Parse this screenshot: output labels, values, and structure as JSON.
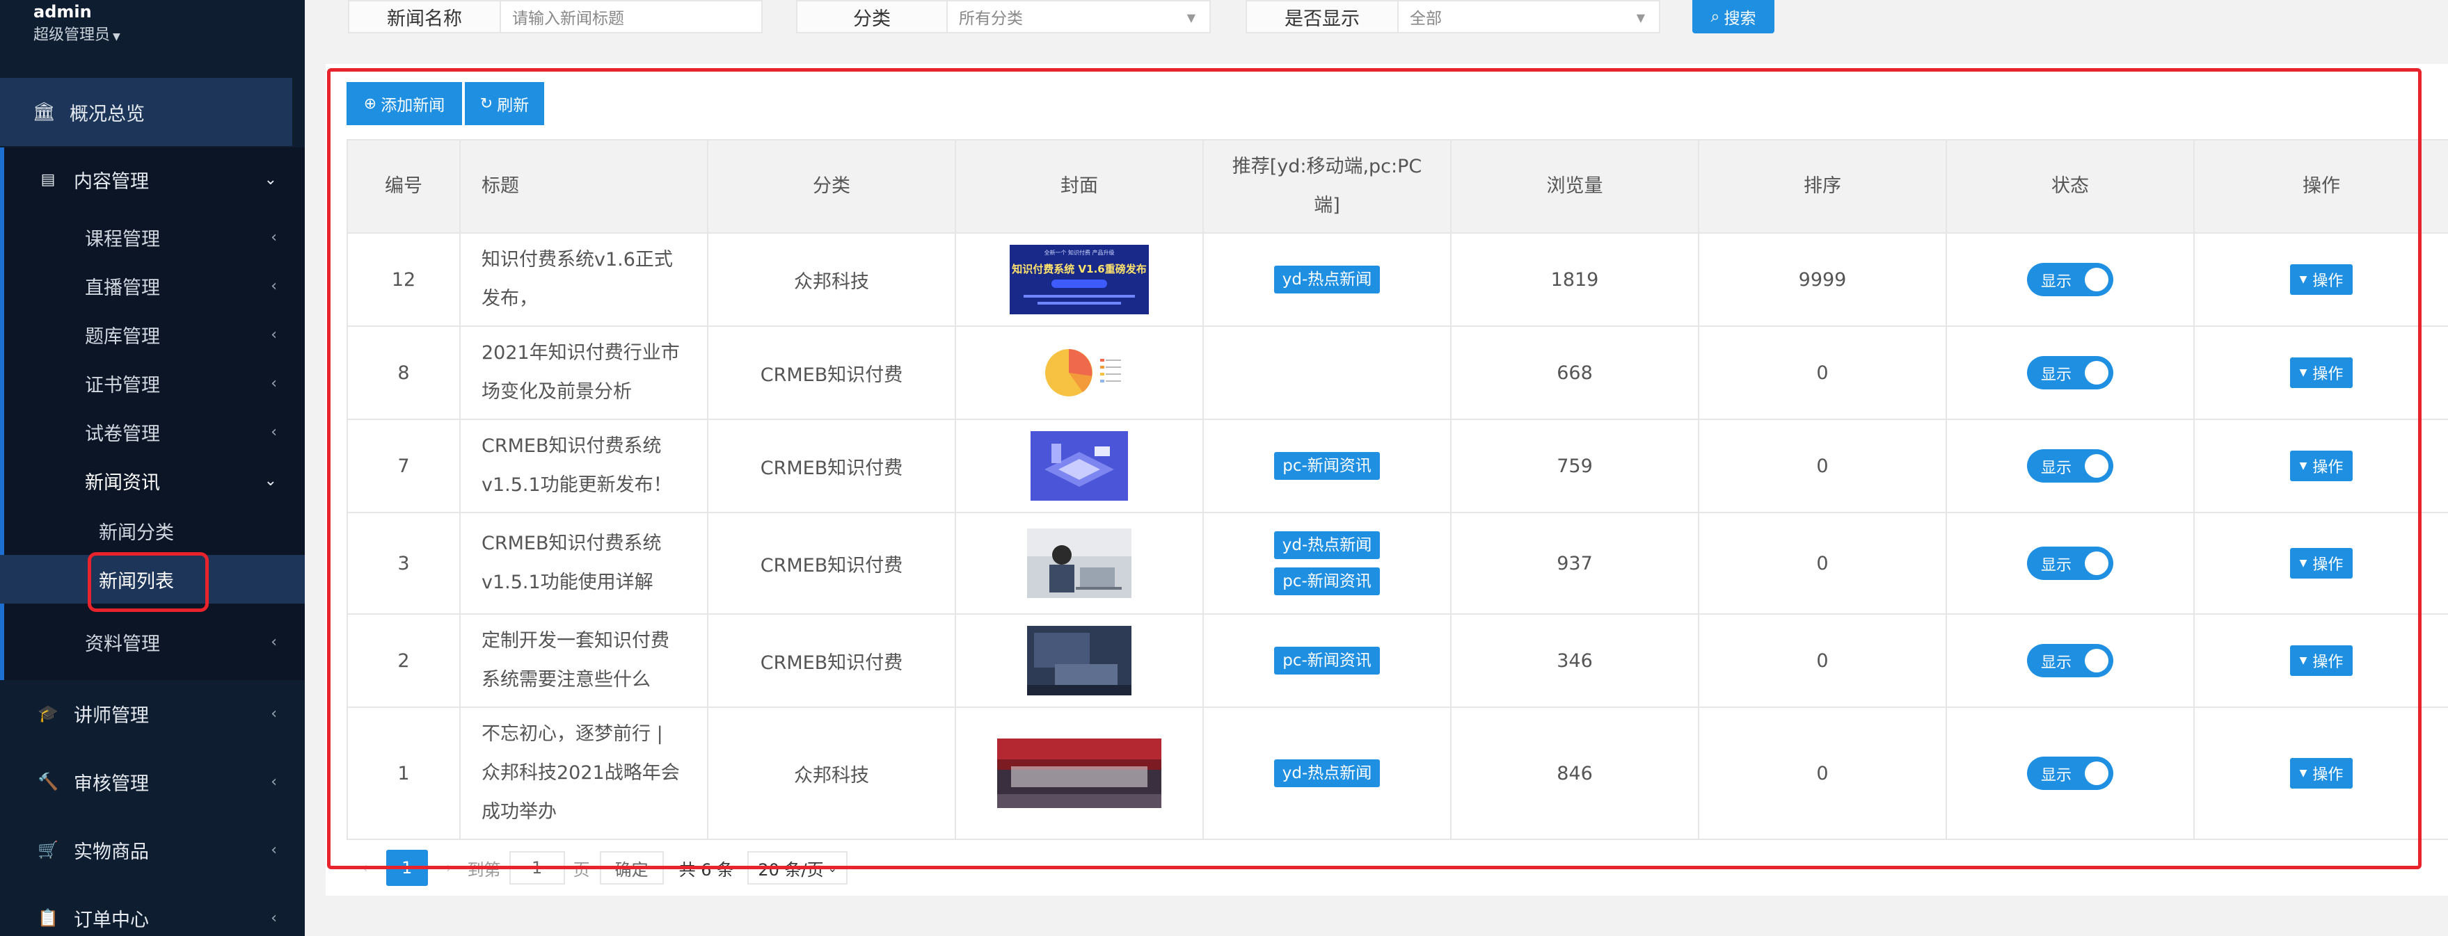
{
  "user": {
    "name": "admin",
    "role": "超级管理员"
  },
  "sidebar": {
    "overview": "概况总览",
    "content": "内容管理",
    "sub": [
      "课程管理",
      "直播管理",
      "题库管理",
      "证书管理",
      "试卷管理",
      "新闻资讯"
    ],
    "news_sub": [
      "新闻分类",
      "新闻列表"
    ],
    "materials": "资料管理",
    "bottom": [
      "讲师管理",
      "审核管理",
      "实物商品",
      "订单中心"
    ]
  },
  "filter": {
    "name_label": "新闻名称",
    "name_placeholder": "请输入新闻标题",
    "category_label": "分类",
    "category_value": "所有分类",
    "show_label": "是否显示",
    "show_value": "全部",
    "search": "搜索"
  },
  "toolbar": {
    "add": "添加新闻",
    "refresh": "刷新"
  },
  "table": {
    "headers": [
      "编号",
      "标题",
      "分类",
      "封面",
      "推荐[yd:移动端,pc:PC端]",
      "浏览量",
      "排序",
      "状态",
      "操作"
    ],
    "rows": [
      {
        "id": "12",
        "title": "知识付费系统v1.6正式发布，",
        "category": "众邦科技",
        "tags": [
          "yd-热点新闻"
        ],
        "views": "1819",
        "sort": "9999",
        "status": "显示",
        "op": "操作",
        "cover_text": "知识付费系统 V1.6重磅发布"
      },
      {
        "id": "8",
        "title": "2021年知识付费行业市场变化及前景分析",
        "category": "CRMEB知识付费",
        "tags": [],
        "views": "668",
        "sort": "0",
        "status": "显示",
        "op": "操作"
      },
      {
        "id": "7",
        "title": "CRMEB知识付费系统v1.5.1功能更新发布！",
        "category": "CRMEB知识付费",
        "tags": [
          "pc-新闻资讯"
        ],
        "views": "759",
        "sort": "0",
        "status": "显示",
        "op": "操作"
      },
      {
        "id": "3",
        "title": "CRMEB知识付费系统v1.5.1功能使用详解",
        "category": "CRMEB知识付费",
        "tags": [
          "yd-热点新闻",
          "pc-新闻资讯"
        ],
        "views": "937",
        "sort": "0",
        "status": "显示",
        "op": "操作"
      },
      {
        "id": "2",
        "title": "定制开发一套知识付费系统需要注意些什么",
        "category": "CRMEB知识付费",
        "tags": [
          "pc-新闻资讯"
        ],
        "views": "346",
        "sort": "0",
        "status": "显示",
        "op": "操作"
      },
      {
        "id": "1",
        "title": "不忘初心，逐梦前行 | 众邦科技2021战略年会成功举办",
        "category": "众邦科技",
        "tags": [
          "yd-热点新闻"
        ],
        "views": "846",
        "sort": "0",
        "status": "显示",
        "op": "操作"
      }
    ]
  },
  "pager": {
    "current": "1",
    "goto": "到第",
    "page_input": "1",
    "page_unit": "页",
    "confirm": "确定",
    "total": "共 6 条",
    "size": "20 条/页"
  },
  "colors": {
    "primary": "#1e8fe1",
    "sidebar": "#0f1d30",
    "highlight": "#e8232b"
  }
}
